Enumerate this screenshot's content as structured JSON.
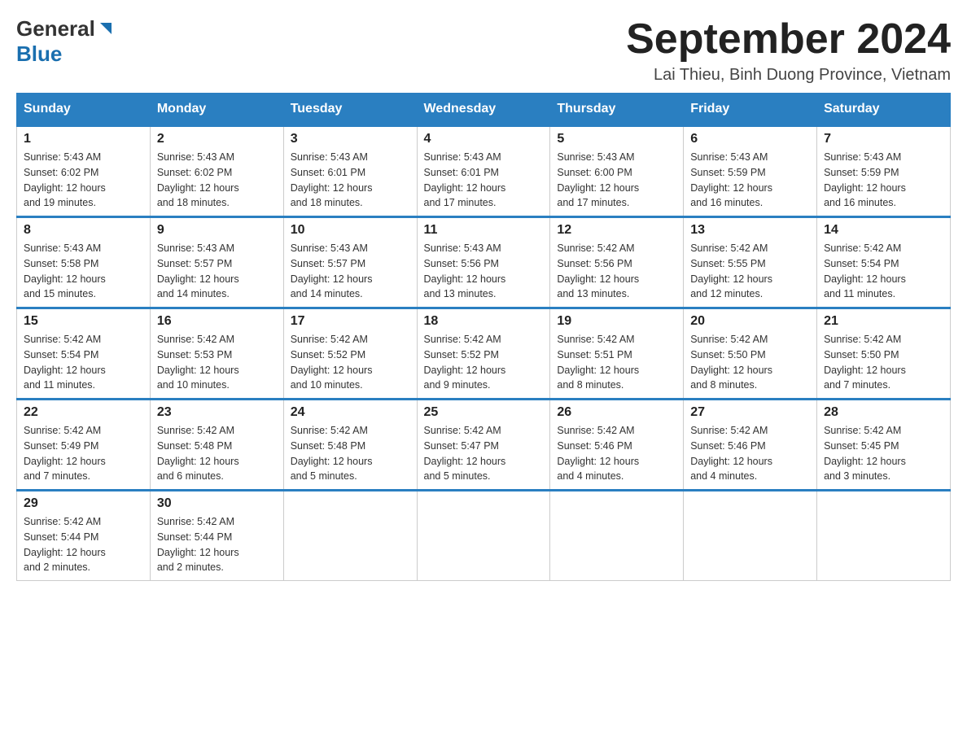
{
  "header": {
    "month_title": "September 2024",
    "location": "Lai Thieu, Binh Duong Province, Vietnam",
    "logo_general": "General",
    "logo_blue": "Blue"
  },
  "weekdays": [
    "Sunday",
    "Monday",
    "Tuesday",
    "Wednesday",
    "Thursday",
    "Friday",
    "Saturday"
  ],
  "weeks": [
    [
      {
        "day": "1",
        "sunrise": "5:43 AM",
        "sunset": "6:02 PM",
        "daylight": "12 hours and 19 minutes."
      },
      {
        "day": "2",
        "sunrise": "5:43 AM",
        "sunset": "6:02 PM",
        "daylight": "12 hours and 18 minutes."
      },
      {
        "day": "3",
        "sunrise": "5:43 AM",
        "sunset": "6:01 PM",
        "daylight": "12 hours and 18 minutes."
      },
      {
        "day": "4",
        "sunrise": "5:43 AM",
        "sunset": "6:01 PM",
        "daylight": "12 hours and 17 minutes."
      },
      {
        "day": "5",
        "sunrise": "5:43 AM",
        "sunset": "6:00 PM",
        "daylight": "12 hours and 17 minutes."
      },
      {
        "day": "6",
        "sunrise": "5:43 AM",
        "sunset": "5:59 PM",
        "daylight": "12 hours and 16 minutes."
      },
      {
        "day": "7",
        "sunrise": "5:43 AM",
        "sunset": "5:59 PM",
        "daylight": "12 hours and 16 minutes."
      }
    ],
    [
      {
        "day": "8",
        "sunrise": "5:43 AM",
        "sunset": "5:58 PM",
        "daylight": "12 hours and 15 minutes."
      },
      {
        "day": "9",
        "sunrise": "5:43 AM",
        "sunset": "5:57 PM",
        "daylight": "12 hours and 14 minutes."
      },
      {
        "day": "10",
        "sunrise": "5:43 AM",
        "sunset": "5:57 PM",
        "daylight": "12 hours and 14 minutes."
      },
      {
        "day": "11",
        "sunrise": "5:43 AM",
        "sunset": "5:56 PM",
        "daylight": "12 hours and 13 minutes."
      },
      {
        "day": "12",
        "sunrise": "5:42 AM",
        "sunset": "5:56 PM",
        "daylight": "12 hours and 13 minutes."
      },
      {
        "day": "13",
        "sunrise": "5:42 AM",
        "sunset": "5:55 PM",
        "daylight": "12 hours and 12 minutes."
      },
      {
        "day": "14",
        "sunrise": "5:42 AM",
        "sunset": "5:54 PM",
        "daylight": "12 hours and 11 minutes."
      }
    ],
    [
      {
        "day": "15",
        "sunrise": "5:42 AM",
        "sunset": "5:54 PM",
        "daylight": "12 hours and 11 minutes."
      },
      {
        "day": "16",
        "sunrise": "5:42 AM",
        "sunset": "5:53 PM",
        "daylight": "12 hours and 10 minutes."
      },
      {
        "day": "17",
        "sunrise": "5:42 AM",
        "sunset": "5:52 PM",
        "daylight": "12 hours and 10 minutes."
      },
      {
        "day": "18",
        "sunrise": "5:42 AM",
        "sunset": "5:52 PM",
        "daylight": "12 hours and 9 minutes."
      },
      {
        "day": "19",
        "sunrise": "5:42 AM",
        "sunset": "5:51 PM",
        "daylight": "12 hours and 8 minutes."
      },
      {
        "day": "20",
        "sunrise": "5:42 AM",
        "sunset": "5:50 PM",
        "daylight": "12 hours and 8 minutes."
      },
      {
        "day": "21",
        "sunrise": "5:42 AM",
        "sunset": "5:50 PM",
        "daylight": "12 hours and 7 minutes."
      }
    ],
    [
      {
        "day": "22",
        "sunrise": "5:42 AM",
        "sunset": "5:49 PM",
        "daylight": "12 hours and 7 minutes."
      },
      {
        "day": "23",
        "sunrise": "5:42 AM",
        "sunset": "5:48 PM",
        "daylight": "12 hours and 6 minutes."
      },
      {
        "day": "24",
        "sunrise": "5:42 AM",
        "sunset": "5:48 PM",
        "daylight": "12 hours and 5 minutes."
      },
      {
        "day": "25",
        "sunrise": "5:42 AM",
        "sunset": "5:47 PM",
        "daylight": "12 hours and 5 minutes."
      },
      {
        "day": "26",
        "sunrise": "5:42 AM",
        "sunset": "5:46 PM",
        "daylight": "12 hours and 4 minutes."
      },
      {
        "day": "27",
        "sunrise": "5:42 AM",
        "sunset": "5:46 PM",
        "daylight": "12 hours and 4 minutes."
      },
      {
        "day": "28",
        "sunrise": "5:42 AM",
        "sunset": "5:45 PM",
        "daylight": "12 hours and 3 minutes."
      }
    ],
    [
      {
        "day": "29",
        "sunrise": "5:42 AM",
        "sunset": "5:44 PM",
        "daylight": "12 hours and 2 minutes."
      },
      {
        "day": "30",
        "sunrise": "5:42 AM",
        "sunset": "5:44 PM",
        "daylight": "12 hours and 2 minutes."
      },
      null,
      null,
      null,
      null,
      null
    ]
  ],
  "labels": {
    "sunrise": "Sunrise:",
    "sunset": "Sunset:",
    "daylight": "Daylight:"
  }
}
